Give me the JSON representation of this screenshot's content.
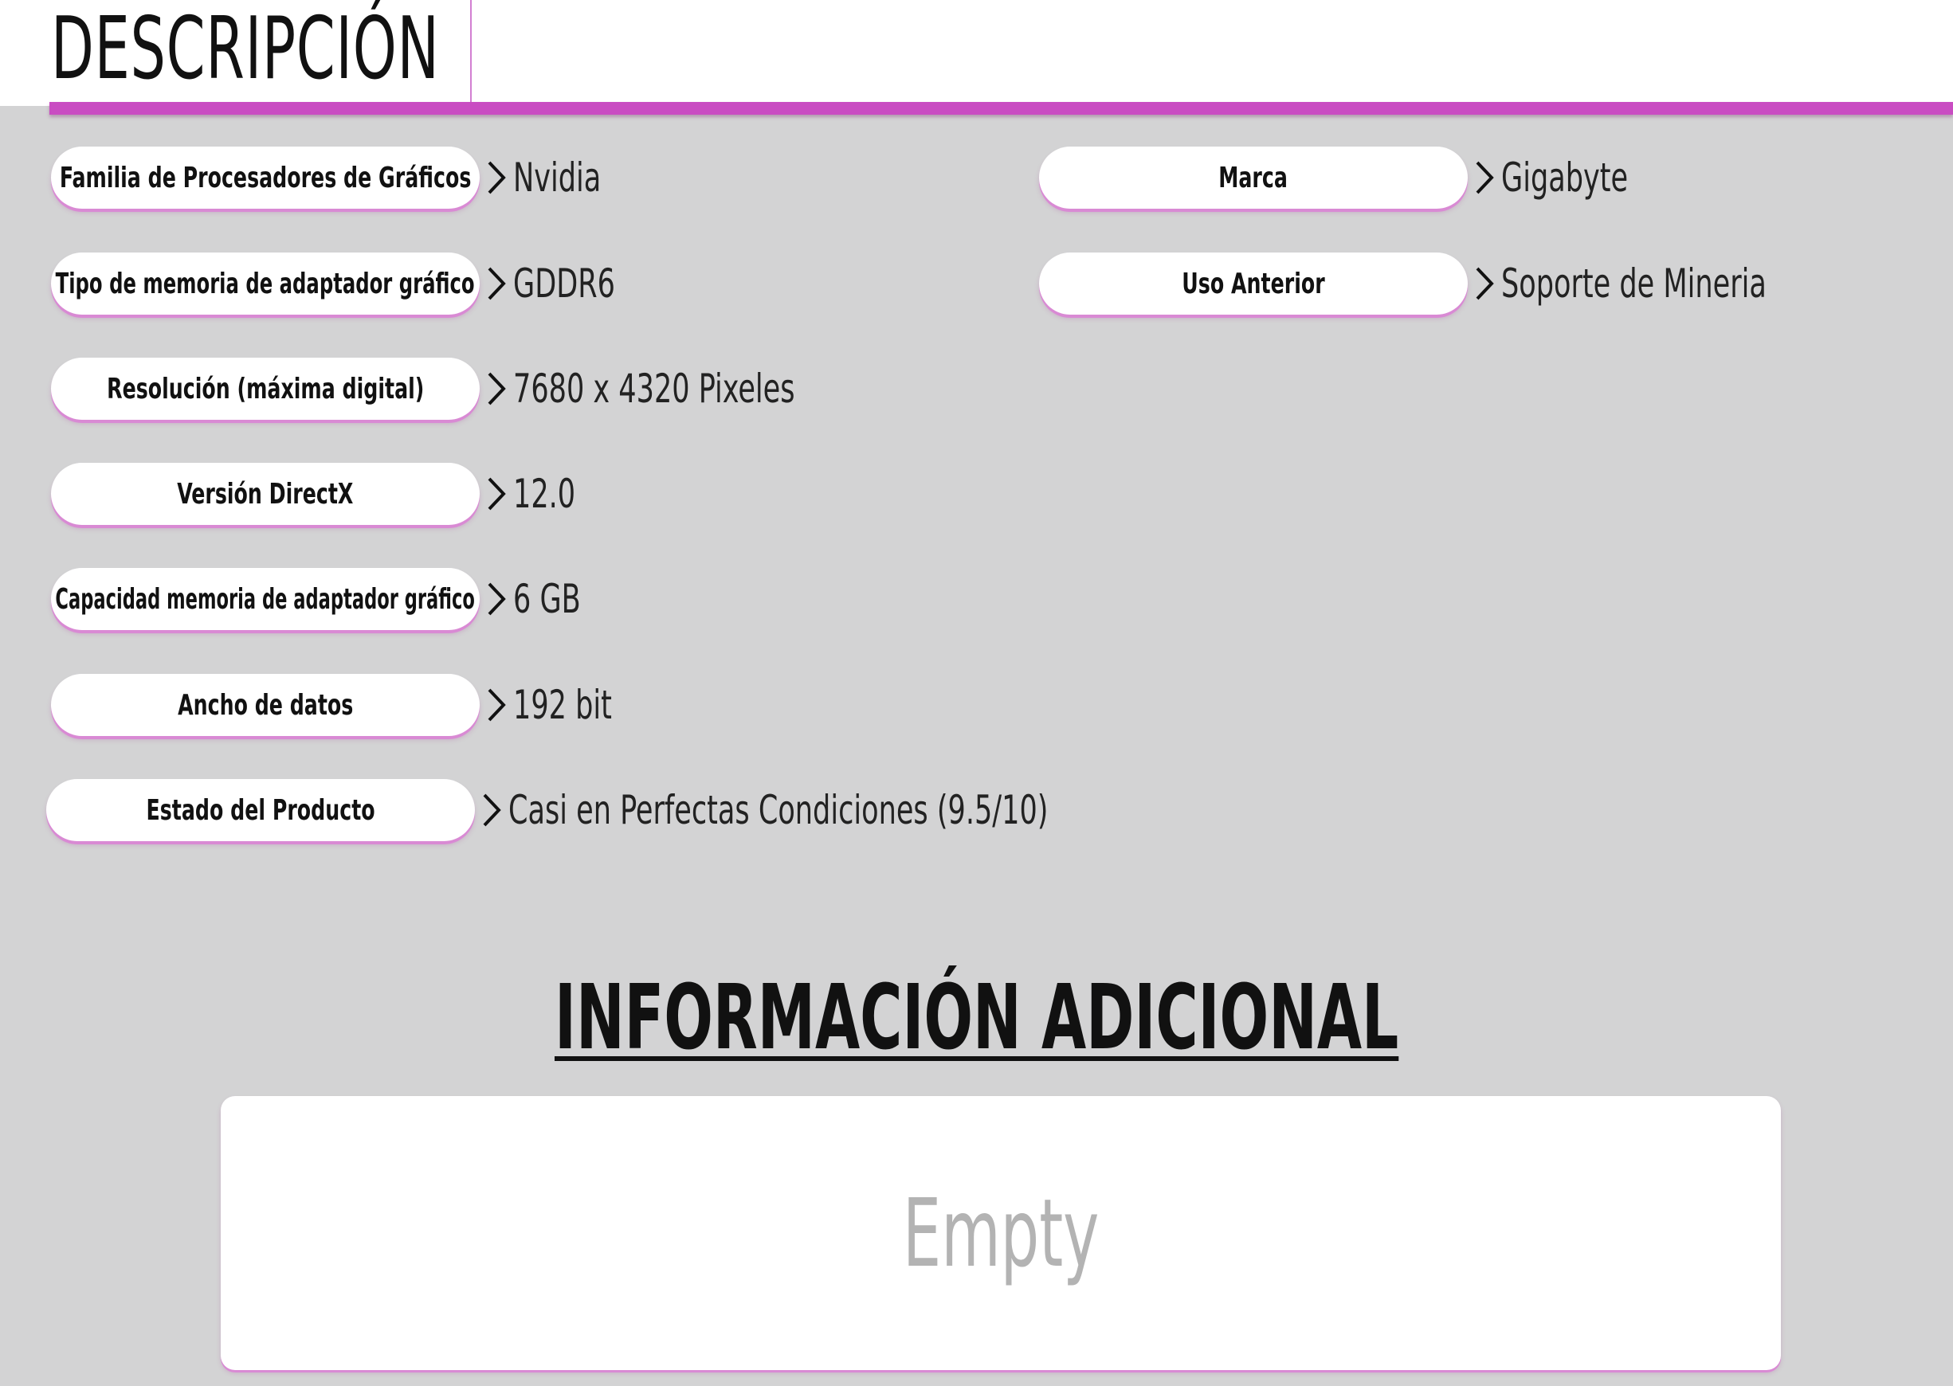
{
  "header": {
    "title": "DESCRIPCIÓN"
  },
  "specs_left": [
    {
      "label": "Familia de Procesadores de Gráficos",
      "value": "Nvidia"
    },
    {
      "label": "Tipo de memoria de adaptador gráfico",
      "value": "GDDR6"
    },
    {
      "label": "Resolución (máxima digital)",
      "value": "7680 x 4320 Pixeles"
    },
    {
      "label": "Versión DirectX",
      "value": "12.0"
    },
    {
      "label": "Capacidad memoria de adaptador gráfico",
      "value": "6 GB"
    },
    {
      "label": "Ancho de datos",
      "value": "192 bit"
    },
    {
      "label": "Estado del Producto",
      "value": "Casi en Perfectas Condiciones (9.5/10)"
    }
  ],
  "specs_right": [
    {
      "label": "Marca",
      "value": "Gigabyte"
    },
    {
      "label": "Uso Anterior",
      "value": "Soporte de Mineria"
    }
  ],
  "additional": {
    "title": "INFORMACIÓN ADICIONAL",
    "content": "Empty"
  },
  "colors": {
    "accent": "#c94cc2",
    "pill_shadow": "#d98ad4",
    "background": "#d3d3d4",
    "header_background": "#ffffff",
    "empty_text": "#b3b3b3"
  },
  "icons": {
    "row_arrow": "chevron-right-icon"
  }
}
